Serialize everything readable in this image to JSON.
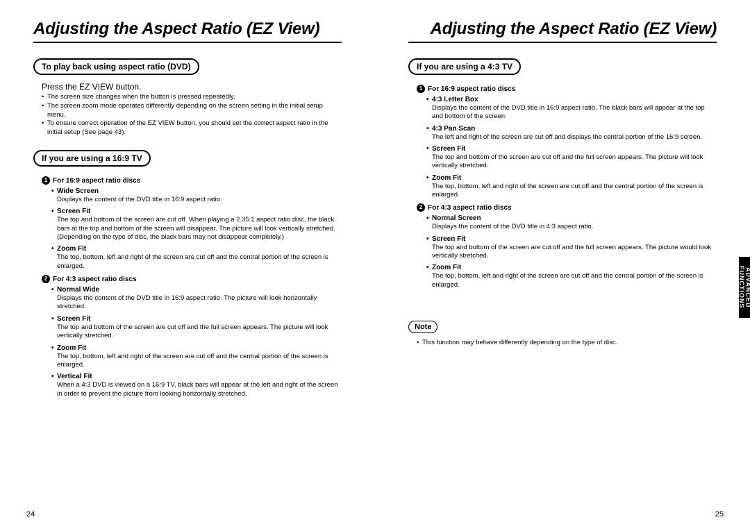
{
  "left": {
    "title": "Adjusting the Aspect Ratio (EZ View)",
    "box1_label": "To play back using aspect ratio (DVD)",
    "intro": "Press the EZ VIEW button.",
    "intro_bullets": [
      "The screen size changes when the button is pressed repeatedly.",
      "The screen zoom mode operates differently depending on the screen setting in the initial setup menu.",
      "To ensure correct operation of the EZ VIEW button, you should set the correct aspect ratio in the initial setup (See page 43)."
    ],
    "box2_label": "If you are using a 16:9 TV",
    "g1": {
      "num": "1",
      "head": "For 16:9 aspect ratio discs",
      "items": [
        {
          "name": "Wide Screen",
          "desc": "Displays the content of the DVD title in 16:9 aspect ratio."
        },
        {
          "name": "Screen Fit",
          "desc": "The top and bottom of the screen are cut off. When playing a 2.35:1 aspect ratio disc, the black bars at the top and bottom of the screen will disappear. The picture will look vertically stretched. (Depending on the type of disc, the black bars may not disappear completely.)"
        },
        {
          "name": "Zoom Fit",
          "desc": "The top, bottom, left and right of the screen are cut off and the central portion of the screen is enlarged."
        }
      ]
    },
    "g2": {
      "num": "2",
      "head": "For 4:3 aspect ratio discs",
      "items": [
        {
          "name": "Normal Wide",
          "desc": "Displays the content of the DVD title in 16:9 aspect ratio. The picture will look horizontally stretched."
        },
        {
          "name": "Screen Fit",
          "desc": "The top and bottom of the screen are cut off and the full screen appears. The picture will look vertically stretched."
        },
        {
          "name": "Zoom Fit",
          "desc": "The top, bottom, left and right of the screen are cut off and the central portion of the screen is enlarged."
        },
        {
          "name": "Vertical Fit",
          "desc": "When a 4:3 DVD is viewed on a 16:9 TV, black bars will appear at the left and right of the screen in order to prevent the picture from looking horizontally stretched."
        }
      ]
    },
    "pgnum": "24"
  },
  "right": {
    "title": "Adjusting the Aspect Ratio (EZ View)",
    "box1_label": "If you are using a 4:3 TV",
    "g1": {
      "num": "1",
      "head": "For 16:9 aspect ratio discs",
      "items": [
        {
          "name": "4:3 Letter Box",
          "desc": "Displays the content of the DVD title in 16:9 aspect ratio. The black bars will appear at the top and bottom of the screen."
        },
        {
          "name": "4:3 Pan Scan",
          "desc": "The left and right of the screen are cut off and displays the central portion of the 16:9 screen."
        },
        {
          "name": "Screen Fit",
          "desc": "The top and bottom of the screen are cut off and the full screen appears. The picture will look vertically stretched."
        },
        {
          "name": "Zoom Fit",
          "desc": "The top, bottom, left and right of the screen are cut off and the central portion of the screen is enlarged."
        }
      ]
    },
    "g2": {
      "num": "2",
      "head": "For 4:3 aspect ratio discs",
      "items": [
        {
          "name": "Normal Screen",
          "desc": "Displays the content of the DVD title in 4:3 aspect ratio."
        },
        {
          "name": "Screen Fit",
          "desc": "The top and bottom of the screen are cut off and the full screen appears. The picture would look vertically stretched."
        },
        {
          "name": "Zoom Fit",
          "desc": "The top, bottom, left and right of the screen are cut off and the central portion of the screen is enlarged."
        }
      ]
    },
    "note_label": "Note",
    "note_text": "This function may behave differently depending on the type of disc.",
    "pgnum": "25",
    "side_tab": "ADVANCED FUNCTIONS"
  }
}
